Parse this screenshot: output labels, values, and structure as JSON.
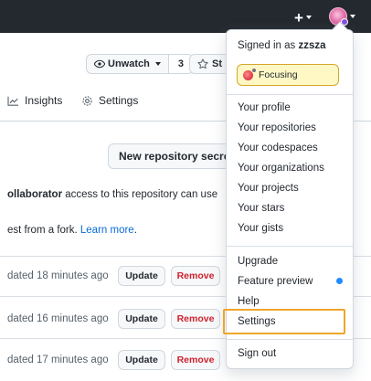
{
  "header": {
    "plus_label": "+",
    "plus_icon": "plus-icon",
    "avatar_icon": "user-avatar"
  },
  "repo": {
    "unwatch_label": "Unwatch",
    "unwatch_count": "3",
    "star_label": "St"
  },
  "tabs": {
    "insights": "Insights",
    "settings": "Settings"
  },
  "secrets": {
    "new_button": "New repository secret",
    "collab_bold": "ollaborator",
    "collab_rest": " access to this repository can use",
    "fork_text": "est from a fork. ",
    "learn_more": "Learn more",
    "fork_end": ".",
    "rows": [
      {
        "updated": "dated 18 minutes ago",
        "update_label": "Update",
        "remove_label": "Remove"
      },
      {
        "updated": "dated 16 minutes ago",
        "update_label": "Update",
        "remove_label": "Remove"
      },
      {
        "updated": "dated 17 minutes ago",
        "update_label": "Update",
        "remove_label": "Remove"
      }
    ]
  },
  "menu": {
    "signed_in_prefix": "Signed in as ",
    "username": "zzsza",
    "status": "Focusing",
    "items_group1": [
      "Your profile",
      "Your repositories",
      "Your codespaces",
      "Your organizations",
      "Your projects",
      "Your stars",
      "Your gists"
    ],
    "items_group2": [
      "Upgrade",
      "Feature preview",
      "Help",
      "Settings"
    ],
    "sign_out": "Sign out"
  },
  "colors": {
    "header_bg": "#24292f",
    "link": "#0969da",
    "danger": "#cf222e",
    "highlight": "#f0a52a",
    "status_bg": "#fff8c5"
  }
}
